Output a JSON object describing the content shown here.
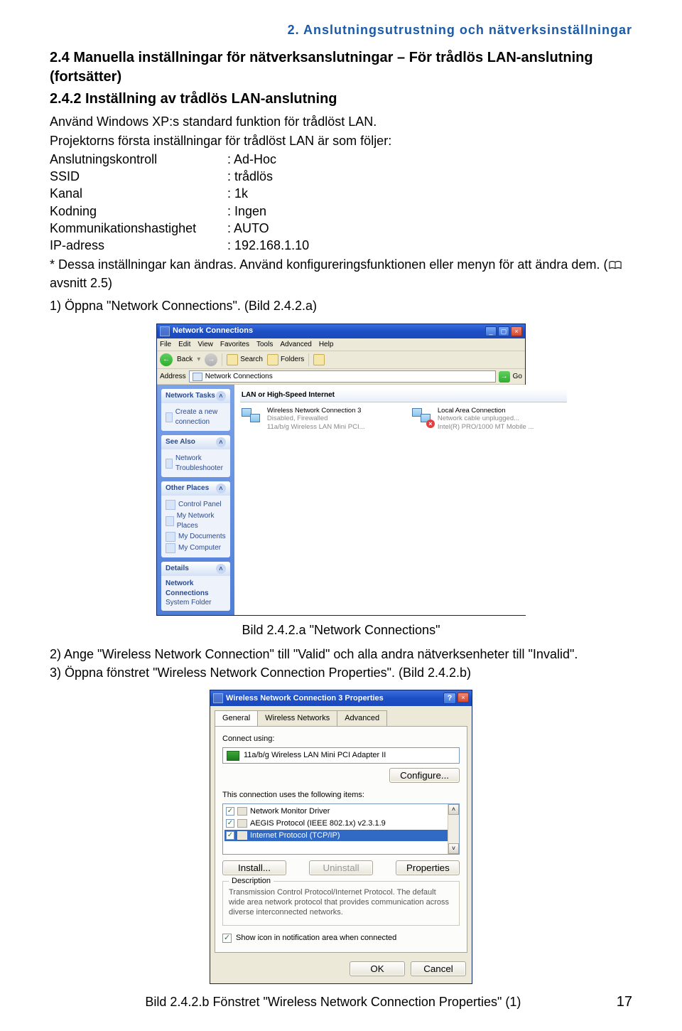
{
  "chapter_header": "2. Anslutningsutrustning och nätverksinställningar",
  "section_title": "2.4 Manuella inställningar för nätverksanslutningar – För trådlös LAN-anslutning (fortsätter)",
  "subsection_title": "2.4.2 Inställning av trådlös LAN-anslutning",
  "intro_line1": "Använd Windows XP:s standard funktion för trådlöst LAN.",
  "intro_line2": "Projektorns första inställningar för trådlöst LAN är som följer:",
  "settings": [
    {
      "label": "Anslutningskontroll",
      "value": ": Ad-Hoc"
    },
    {
      "label": "SSID",
      "value": ": trådlös"
    },
    {
      "label": "Kanal",
      "value": ": 1k"
    },
    {
      "label": "Kodning",
      "value": ": Ingen"
    },
    {
      "label": "Kommunikationshastighet",
      "value": ": AUTO"
    },
    {
      "label": "IP-adress",
      "value": ": 192.168.1.10"
    }
  ],
  "note_line": "* Dessa inställningar kan ändras. Använd konfigureringsfunktionen eller menyn för att ändra dem. (",
  "note_ref": " avsnitt 2.5)",
  "step1": "1) Öppna \"Network Connections\". (Bild 2.4.2.a)",
  "figA": {
    "title": "Network Connections",
    "menu": [
      "File",
      "Edit",
      "View",
      "Favorites",
      "Tools",
      "Advanced",
      "Help"
    ],
    "back": "Back",
    "search": "Search",
    "folders": "Folders",
    "addr_label": "Address",
    "addr_value": "Network Connections",
    "go": "Go",
    "panel1_title": "Network Tasks",
    "panel1_item": "Create a new connection",
    "panel2_title": "See Also",
    "panel2_item": "Network Troubleshooter",
    "panel3_title": "Other Places",
    "panel3_items": [
      "Control Panel",
      "My Network Places",
      "My Documents",
      "My Computer"
    ],
    "panel4_title": "Details",
    "panel4_line1": "Network Connections",
    "panel4_line2": "System Folder",
    "category": "LAN or High-Speed Internet",
    "conn1_title": "Wireless Network Connection 3",
    "conn1_sub1": "Disabled, Firewalled",
    "conn1_sub2": "11a/b/g Wireless LAN Mini PCI...",
    "conn2_title": "Local Area Connection",
    "conn2_sub1": "Network cable unplugged...",
    "conn2_sub2": "Intel(R) PRO/1000 MT Mobile ..."
  },
  "captionA": "Bild 2.4.2.a \"Network Connections\"",
  "step2": "2) Ange \"Wireless Network Connection\" till \"Valid\" och alla andra nätverksenheter till \"Invalid\".",
  "step3": "3) Öppna fönstret \"Wireless Network Connection Properties\". (Bild 2.4.2.b)",
  "figB": {
    "title": "Wireless Network Connection 3 Properties",
    "tabs": [
      "General",
      "Wireless Networks",
      "Advanced"
    ],
    "connect_using": "Connect using:",
    "adapter": "11a/b/g Wireless LAN Mini PCI Adapter II",
    "configure": "Configure...",
    "items_label": "This connection uses the following items:",
    "item1": "Network Monitor Driver",
    "item2": "AEGIS Protocol (IEEE 802.1x) v2.3.1.9",
    "item3": "Internet Protocol (TCP/IP)",
    "install": "Install...",
    "uninstall": "Uninstall",
    "properties": "Properties",
    "desc_label": "Description",
    "desc_text": "Transmission Control Protocol/Internet Protocol. The default wide area network protocol that provides communication across diverse interconnected networks.",
    "show_icon": "Show icon in notification area when connected",
    "ok": "OK",
    "cancel": "Cancel"
  },
  "captionB": "Bild 2.4.2.b Fönstret \"Wireless Network Connection Properties\" (1)",
  "page_number": "17"
}
